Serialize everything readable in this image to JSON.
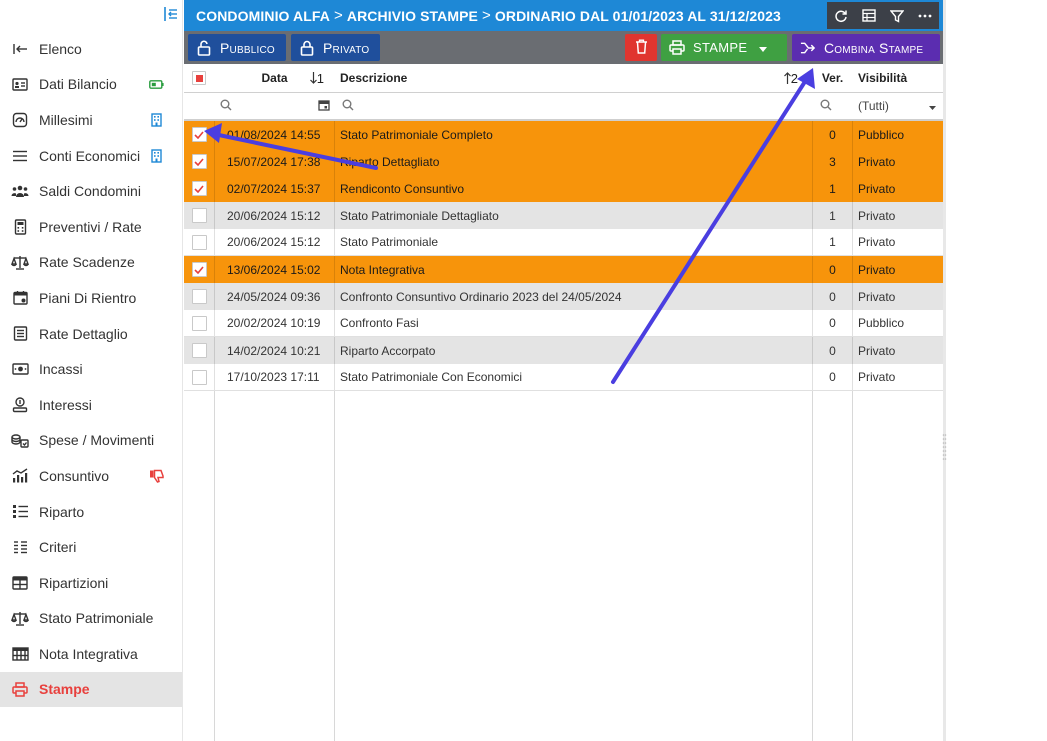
{
  "colors": {
    "header_blue": "#1e88d6",
    "toolbar_gray": "#6a6d72",
    "btn_blue": "#1f4f9c",
    "btn_red": "#e0352f",
    "btn_green": "#3fa042",
    "btn_purple": "#5b2db0",
    "row_selected": "#f7940b",
    "row_alt": "#e4e4e4",
    "accent_red": "#e8403d",
    "annotation_arrow": "#4a3ee0"
  },
  "sidebar": {
    "collapse_icon": "sidebar-collapse-icon",
    "items": [
      {
        "label": "Elenco",
        "icon": "back-arrow-icon"
      },
      {
        "label": "Dati Bilancio",
        "icon": "id-card-icon",
        "extra": "battery-icon"
      },
      {
        "label": "Millesimi",
        "icon": "gauge-icon",
        "extra": "building-icon"
      },
      {
        "label": "Conti Economici",
        "icon": "lines-icon",
        "extra": "building-icon"
      },
      {
        "label": "Saldi Condomini",
        "icon": "people-icon"
      },
      {
        "label": "Preventivi / Rate",
        "icon": "calculator-icon"
      },
      {
        "label": "Rate Scadenze",
        "icon": "scale-icon"
      },
      {
        "label": "Piani Di Rientro",
        "icon": "calendar-icon"
      },
      {
        "label": "Rate Dettaglio",
        "icon": "list-icon"
      },
      {
        "label": "Incassi",
        "icon": "money-icon"
      },
      {
        "label": "Interessi",
        "icon": "coin-hand-icon"
      },
      {
        "label": "Spese / Movimenti",
        "icon": "coins-icon"
      },
      {
        "label": "Consuntivo",
        "icon": "chart-icon",
        "extra": "thumbs-down-icon"
      },
      {
        "label": "Riparto",
        "icon": "ordered-list-icon"
      },
      {
        "label": "Criteri",
        "icon": "text-list-icon"
      },
      {
        "label": "Ripartizioni",
        "icon": "table-icon"
      },
      {
        "label": "Stato Patrimoniale",
        "icon": "scale-icon"
      },
      {
        "label": "Nota Integrativa",
        "icon": "grid-icon"
      },
      {
        "label": "Stampe",
        "icon": "printer-icon",
        "active": true
      }
    ]
  },
  "breadcrumb": {
    "part1": "CONDOMINIO ALFA",
    "part2": "ARCHIVIO STAMPE",
    "part3": "ORDINARIO DAL 01/01/2023 AL 31/12/2023",
    "separator": ">"
  },
  "toolbar": {
    "pubblico_label": "Pubblico",
    "privato_label": "Privato",
    "stampe_label": "STAMPE",
    "combina_label": "Combina Stampe"
  },
  "grid": {
    "headers": {
      "data": "Data",
      "data_sort": "1",
      "descrizione": "Descrizione",
      "descrizione_sort": "2",
      "ver": "Ver.",
      "visibilita": "Visibilità"
    },
    "filter": {
      "visibilita_value": "(Tutti)"
    },
    "rows": [
      {
        "checked": true,
        "data": "01/08/2024 14:55",
        "descrizione": "Stato Patrimoniale Completo",
        "ver": "0",
        "visibilita": "Pubblico"
      },
      {
        "checked": true,
        "data": "15/07/2024 17:38",
        "descrizione": "Riparto Dettagliato",
        "ver": "3",
        "visibilita": "Privato"
      },
      {
        "checked": true,
        "data": "02/07/2024 15:37",
        "descrizione": "Rendiconto Consuntivo",
        "ver": "1",
        "visibilita": "Privato"
      },
      {
        "checked": false,
        "data": "20/06/2024 15:12",
        "descrizione": "Stato Patrimoniale Dettagliato",
        "ver": "1",
        "visibilita": "Privato"
      },
      {
        "checked": false,
        "data": "20/06/2024 15:12",
        "descrizione": "Stato Patrimoniale",
        "ver": "1",
        "visibilita": "Privato"
      },
      {
        "checked": true,
        "data": "13/06/2024 15:02",
        "descrizione": "Nota Integrativa",
        "ver": "0",
        "visibilita": "Privato"
      },
      {
        "checked": false,
        "data": "24/05/2024 09:36",
        "descrizione": "Confronto Consuntivo Ordinario 2023 del 24/05/2024",
        "ver": "0",
        "visibilita": "Privato"
      },
      {
        "checked": false,
        "data": "20/02/2024 10:19",
        "descrizione": "Confronto Fasi",
        "ver": "0",
        "visibilita": "Pubblico"
      },
      {
        "checked": false,
        "data": "14/02/2024 10:21",
        "descrizione": "Riparto Accorpato",
        "ver": "0",
        "visibilita": "Privato"
      },
      {
        "checked": false,
        "data": "17/10/2023 17:11",
        "descrizione": "Stato Patrimoniale Con Economici",
        "ver": "0",
        "visibilita": "Privato"
      }
    ]
  }
}
